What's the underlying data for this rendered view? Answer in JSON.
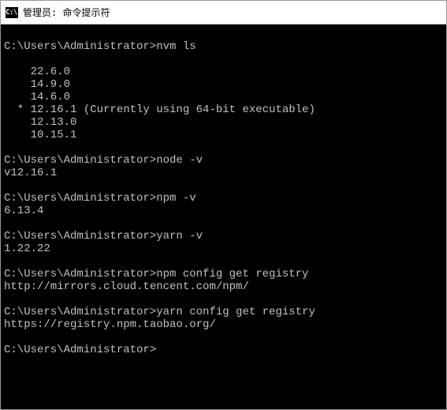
{
  "window": {
    "icon_text": "C:\\.",
    "title": "管理员: 命令提示符"
  },
  "terminal": {
    "prompt": "C:\\Users\\Administrator>",
    "blocks": [
      {
        "cmd": "nvm ls",
        "out": [
          "",
          "    22.6.0",
          "    14.9.0",
          "    14.6.0",
          "  * 12.16.1 (Currently using 64-bit executable)",
          "    12.13.0",
          "    10.15.1",
          ""
        ]
      },
      {
        "cmd": "node -v",
        "out": [
          "v12.16.1",
          ""
        ]
      },
      {
        "cmd": "npm -v",
        "out": [
          "6.13.4",
          ""
        ]
      },
      {
        "cmd": "yarn -v",
        "out": [
          "1.22.22",
          ""
        ]
      },
      {
        "cmd": "npm config get registry",
        "out": [
          "http://mirrors.cloud.tencent.com/npm/",
          ""
        ]
      },
      {
        "cmd": "yarn config get registry",
        "out": [
          "https://registry.npm.taobao.org/",
          ""
        ]
      },
      {
        "cmd": "",
        "out": []
      }
    ]
  }
}
